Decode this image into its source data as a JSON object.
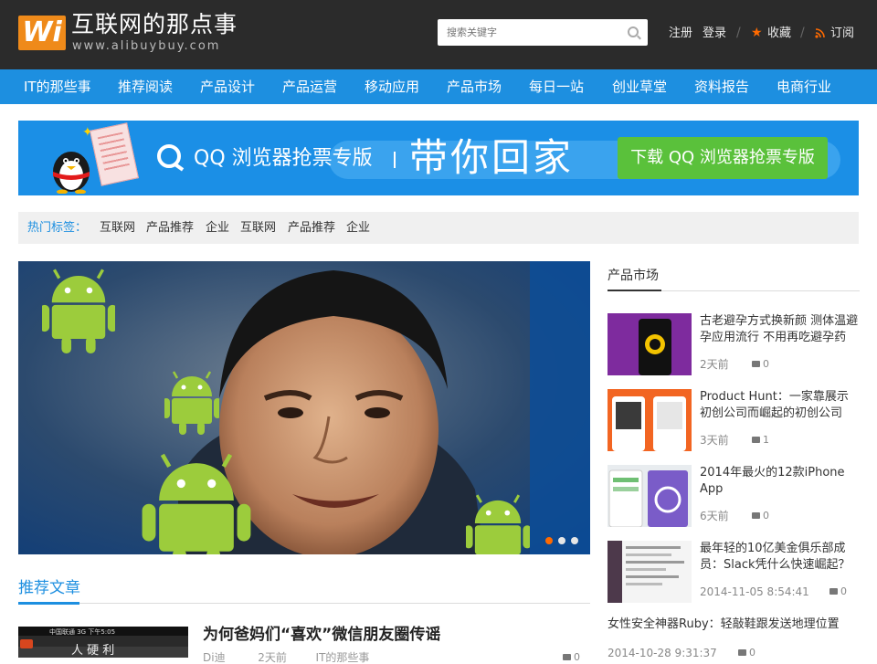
{
  "header": {
    "logo_mark": "Wi",
    "site_name": "互联网的那点事",
    "site_url": "www.alibuybuy.com",
    "search_placeholder": "搜索关键字",
    "register": "注册",
    "login": "登录",
    "favorite": "收藏",
    "subscribe": "订阅",
    "separator": "/",
    "accent_color": "#ff6a00"
  },
  "nav": {
    "bg_color": "#1d8fe0",
    "items": [
      "IT的那些事",
      "推荐阅读",
      "产品设计",
      "产品运营",
      "移动应用",
      "产品市场",
      "每日一站",
      "创业草堂",
      "资料报告",
      "电商行业"
    ]
  },
  "banner": {
    "product": "QQ 浏览器抢票专版",
    "slogan": "带你回家",
    "button": "下载 QQ 浏览器抢票专版"
  },
  "tags": {
    "label": "热门标签：",
    "items": [
      "互联网",
      "产品推荐",
      "企业",
      "互联网",
      "产品推荐",
      "企业"
    ]
  },
  "slider": {
    "dots": 3,
    "active_index": 0
  },
  "recommended": {
    "title": "推荐文章",
    "article": {
      "thumb_text": "中国联通 3G   下午5:05",
      "title": "为何爸妈们“喜欢”微信朋友圈传谣",
      "author": "Di迪",
      "time": "2天前",
      "category": "IT的那些事",
      "comments": "0"
    }
  },
  "sidebar": {
    "title": "产品市场",
    "items": [
      {
        "title": "古老避孕方式换新颜 测体温避孕应用流行 不用再吃避孕药",
        "time": "2天前",
        "comments": "0",
        "thumb_color": "#7e2b9e"
      },
      {
        "title": "Product Hunt：一家靠展示初创公司而崛起的初创公司",
        "time": "3天前",
        "comments": "1",
        "thumb_color": "#f26522"
      },
      {
        "title": "2014年最火的12款iPhone App",
        "time": "6天前",
        "comments": "0",
        "thumb_color": "#e8ecef"
      },
      {
        "title": "最年轻的10亿美金俱乐部成员：Slack凭什么快速崛起？",
        "time": "2014-11-05 8:54:41",
        "comments": "0",
        "thumb_color": "#f4f4f4"
      }
    ],
    "plain_item": {
      "title": "女性安全神器Ruby：轻敲鞋跟发送地理位置",
      "time": "2014-10-28 9:31:37",
      "comments": "0"
    }
  }
}
